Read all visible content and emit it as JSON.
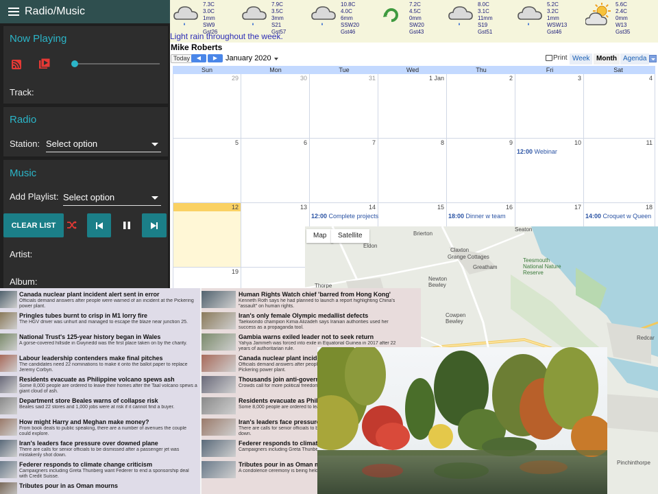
{
  "sidebar": {
    "title": "Radio/Music",
    "now_playing": {
      "heading": "Now Playing",
      "track_label": "Track:",
      "progress": 0.0
    },
    "radio": {
      "heading": "Radio",
      "station_label": "Station:",
      "station_value": "Select option"
    },
    "music": {
      "heading": "Music",
      "playlist_label": "Add Playlist:",
      "playlist_value": "Select option",
      "clear_label": "CLEAR LIST",
      "artist_label": "Artist:",
      "album_label": "Album:"
    }
  },
  "weather": {
    "days": [
      {
        "icon": "rain-cloud-icon",
        "lines": [
          "7.3C",
          "3.0C",
          "1mm",
          "SW9",
          "Gst26"
        ]
      },
      {
        "icon": "rain-cloud-icon",
        "lines": [
          "7.9C",
          "3.5C",
          "3mm",
          "S21",
          "Gst57"
        ]
      },
      {
        "icon": "rain-cloud-icon",
        "lines": [
          "10.8C",
          "4.0C",
          "6mm",
          "SSW20",
          "Gst46"
        ]
      },
      {
        "icon": "wind-swirl-icon",
        "lines": [
          "7.2C",
          "4.5C",
          "0mm",
          "SW20",
          "Gst43"
        ]
      },
      {
        "icon": "rain-cloud-icon",
        "lines": [
          "8.0C",
          "3.1C",
          "11mm",
          "S19",
          "Gst51"
        ]
      },
      {
        "icon": "rain-cloud-icon",
        "lines": [
          "5.2C",
          "3.2C",
          "1mm",
          "WSW13",
          "Gst46"
        ]
      },
      {
        "icon": "sun-cloud-icon",
        "lines": [
          "5.6C",
          "2.4C",
          "0mm",
          "W13",
          "Gst35"
        ]
      }
    ],
    "summary": "Light rain throughout the week."
  },
  "calendar": {
    "owner": "Mike Roberts",
    "today_label": "Today",
    "month": "January 2020",
    "print_label": "Print",
    "views": [
      "Week",
      "Month",
      "Agenda"
    ],
    "active_view": "Month",
    "day_names": [
      "Sun",
      "Mon",
      "Tue",
      "Wed",
      "Thu",
      "Fri",
      "Sat"
    ],
    "weeks": [
      [
        {
          "d": "29",
          "o": true
        },
        {
          "d": "30",
          "o": true
        },
        {
          "d": "31",
          "o": true
        },
        {
          "d": "1 Jan"
        },
        {
          "d": "2"
        },
        {
          "d": "3"
        },
        {
          "d": "4"
        }
      ],
      [
        {
          "d": "5"
        },
        {
          "d": "6"
        },
        {
          "d": "7"
        },
        {
          "d": "8"
        },
        {
          "d": "9"
        },
        {
          "d": "10"
        },
        {
          "d": "11"
        }
      ],
      [
        {
          "d": "12",
          "today": true
        },
        {
          "d": "13"
        },
        {
          "d": "14"
        },
        {
          "d": "15"
        },
        {
          "d": "16"
        },
        {
          "d": "17"
        },
        {
          "d": "18"
        }
      ],
      [
        {
          "d": "19"
        },
        {
          "d": ""
        },
        {
          "d": ""
        },
        {
          "d": ""
        },
        {
          "d": ""
        },
        {
          "d": ""
        },
        {
          "d": ""
        }
      ]
    ],
    "events": [
      {
        "week": 1,
        "day": 5,
        "time": "12:00",
        "title": "Webinar"
      },
      {
        "week": 2,
        "day": 2,
        "time": "12:00",
        "title": "Complete projects"
      },
      {
        "week": 2,
        "day": 4,
        "time": "18:00",
        "title": "Dinner w team"
      },
      {
        "week": 2,
        "day": 6,
        "time": "14:00",
        "title": "Croquet w Queen"
      }
    ]
  },
  "map": {
    "tabs": [
      "Map",
      "Satellite"
    ],
    "places": [
      "Brierton",
      "Claxton",
      "Grange Cottages",
      "Greatham",
      "Newton Bewley",
      "Teesmouth National Nature Reserve",
      "Cowpen Bewley",
      "Thorpe",
      "Redcar",
      "Pinchinthorpe",
      "Eldon",
      "Seaton"
    ]
  },
  "news": {
    "left": [
      {
        "title": "Canada nuclear plant incident alert sent in error",
        "desc": "Officials demand answers after people were warned of an incident at the Pickering power plant."
      },
      {
        "title": "Pringles tubes burnt to crisp in M1 lorry fire",
        "desc": "The HGV driver was unhurt and managed to escape the blaze near junction 25."
      },
      {
        "title": "National Trust's 125-year history began in Wales",
        "desc": "A gorse-covered hillside in Gwynedd was the first place taken on by the charity."
      },
      {
        "title": "Labour leadership contenders make final pitches",
        "desc": "The candidates need 22 nominations to make it onto the ballot paper to replace Jeremy Corbyn."
      },
      {
        "title": "Residents evacuate as Philippine volcano spews ash",
        "desc": "Some 8,000 people are ordered to leave their homes after the Taal volcano spews a giant cloud of ash."
      },
      {
        "title": "Department store Beales warns of collapse risk",
        "desc": "Beales said 22 stores and 1,000 jobs were at risk if it cannot find a buyer."
      },
      {
        "title": "How might Harry and Meghan make money?",
        "desc": "From book deals to public speaking, there are a number of avenues the couple could explore."
      },
      {
        "title": "Iran's leaders face pressure over downed plane",
        "desc": "There are calls for senior officials to be dismissed after a passenger jet was mistakenly shot down."
      },
      {
        "title": "Federer responds to climate change criticism",
        "desc": "Campaigners including Greta Thunberg want Federer to end a sponsorship deal with Credit Suisse."
      },
      {
        "title": "Tributes pour in as Oman mourns",
        "desc": ""
      }
    ],
    "right": [
      {
        "title": "Human Rights Watch chief 'barred from Hong Kong'",
        "desc": "Kenneth Roth says he had planned to launch a report highlighting China's \"assault\" on human rights."
      },
      {
        "title": "Iran's only female Olympic medallist defects",
        "desc": "Taekwondo champion Kimia Alizadeh says Iranian authorities used her success as a propaganda tool."
      },
      {
        "title": "Gambia warns exiled leader not to seek return",
        "desc": "Yahya Jammeh was forced into exile in Equatorial Guinea in 2017 after 22 years of authoritarian rule."
      },
      {
        "title": "Canada nuclear plant incident",
        "desc": "Officials demand answers after people were warned of an incident at the Pickering power plant."
      },
      {
        "title": "Thousands join anti-government",
        "desc": "Crowds call for more political freedom and the government."
      },
      {
        "title": "Residents evacuate as Philipp",
        "desc": "Some 8,000 people are ordered to leave a giant cloud of ash."
      },
      {
        "title": "Iran's leaders face pressure ov",
        "desc": "There are calls for senior officials to be dismissed after mistakenly shot down."
      },
      {
        "title": "Federer responds to climate c",
        "desc": "Campaigners including Greta Thunberg with Credit Suisse."
      },
      {
        "title": "Tributes pour in as Oman mo",
        "desc": "A condolence ceremony is being held for who died aged 79."
      }
    ]
  },
  "colors": {
    "sidebar_bg": "#1f1f1f",
    "header_bg": "#2f4f4f",
    "accent_teal": "#2bb5c8",
    "button_teal": "#1b7f88",
    "icon_red": "#e53935",
    "weather_bg": "#f5f5dc",
    "calendar_header": "#c3d9ff",
    "today_yellow": "#fad163"
  }
}
